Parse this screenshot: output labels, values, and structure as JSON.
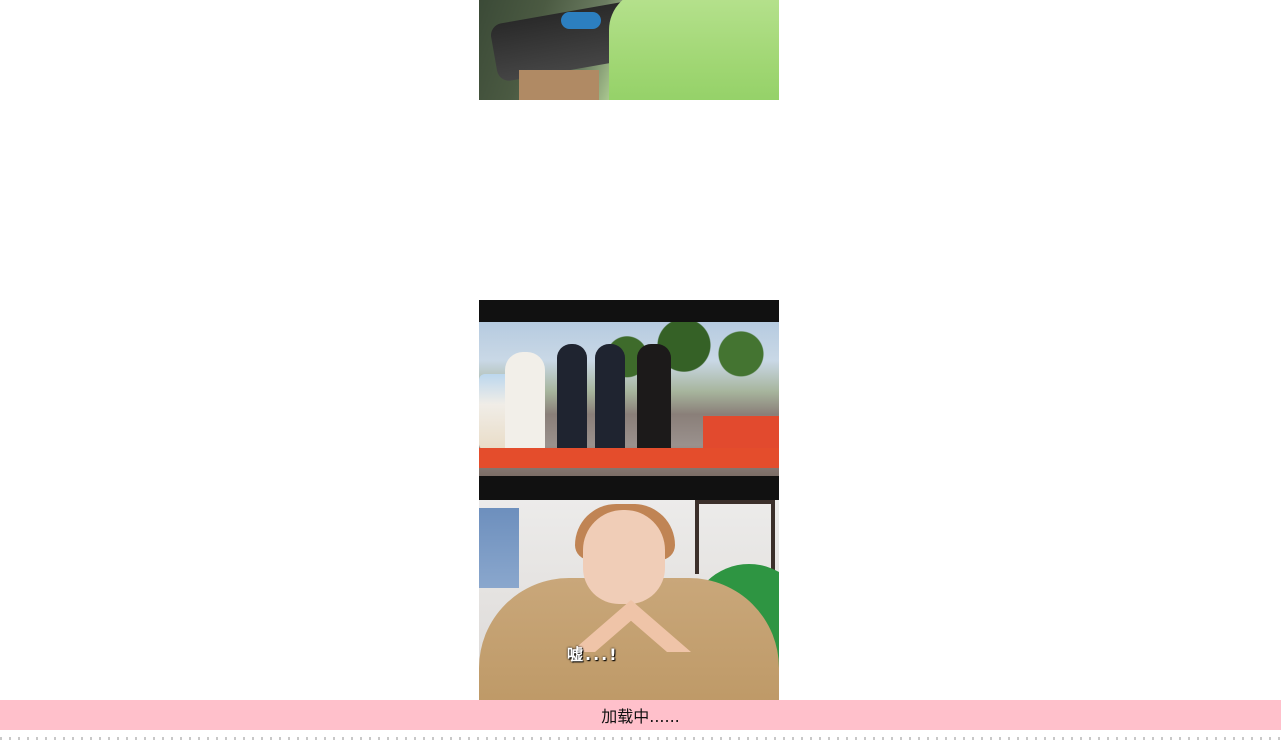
{
  "feed": {
    "items": [
      {
        "kind": "video-thumbnail",
        "caption": ""
      },
      {
        "kind": "video-thumbnail",
        "caption": ""
      },
      {
        "kind": "video-thumbnail",
        "caption": "嘘...!"
      }
    ]
  },
  "loading": {
    "text": "加载中......",
    "background": "#ffc0cb"
  }
}
